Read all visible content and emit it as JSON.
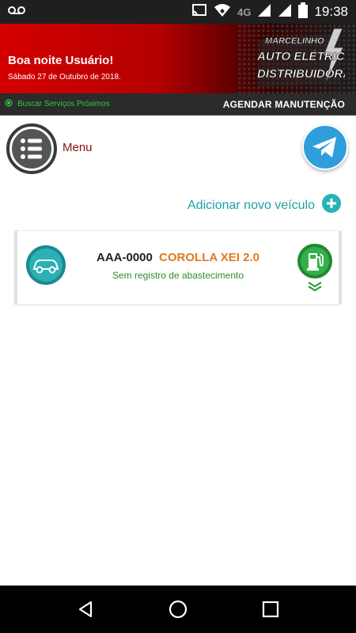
{
  "status_bar": {
    "time": "19:38",
    "network": "4G",
    "icons": [
      "voicemail-icon",
      "cast-icon",
      "wifi-icon",
      "signal-icon",
      "signal-icon",
      "battery-icon"
    ]
  },
  "header": {
    "greeting": "Boa noite Usuário!",
    "date": "Sábado 27 de Outubro de 2018.",
    "logo_text": [
      "MARCELINHO",
      "AUTO ELÉTRICA",
      "DISTRIBUIDORA"
    ]
  },
  "subbar": {
    "services_label": "Buscar Serviços Próximos",
    "schedule_label": "AGENDAR MANUTENÇÃO"
  },
  "menu": {
    "label": "Menu",
    "icon": "menu-list-icon"
  },
  "telegram": {
    "icon": "telegram-icon"
  },
  "add_vehicle": {
    "label": "Adicionar novo veículo",
    "icon": "plus-circle-icon"
  },
  "vehicles": [
    {
      "plate": "AAA-0000",
      "model": "COROLLA XEI 2.0",
      "status": "Sem registro de abastecimento",
      "icon": "car-icon",
      "action_icon": "fuel-pump-icon",
      "expand_icon": "chevron-down-double-icon"
    }
  ],
  "colors": {
    "brand_red": "#d40000",
    "teal": "#1e9fa6",
    "orange": "#e07a1f",
    "green_status": "#2a8f2a",
    "menu_label": "#8b0d0d",
    "telegram_blue": "#2e9fdc"
  },
  "navbar": {
    "buttons": [
      "back-icon",
      "home-icon",
      "recents-icon"
    ]
  }
}
